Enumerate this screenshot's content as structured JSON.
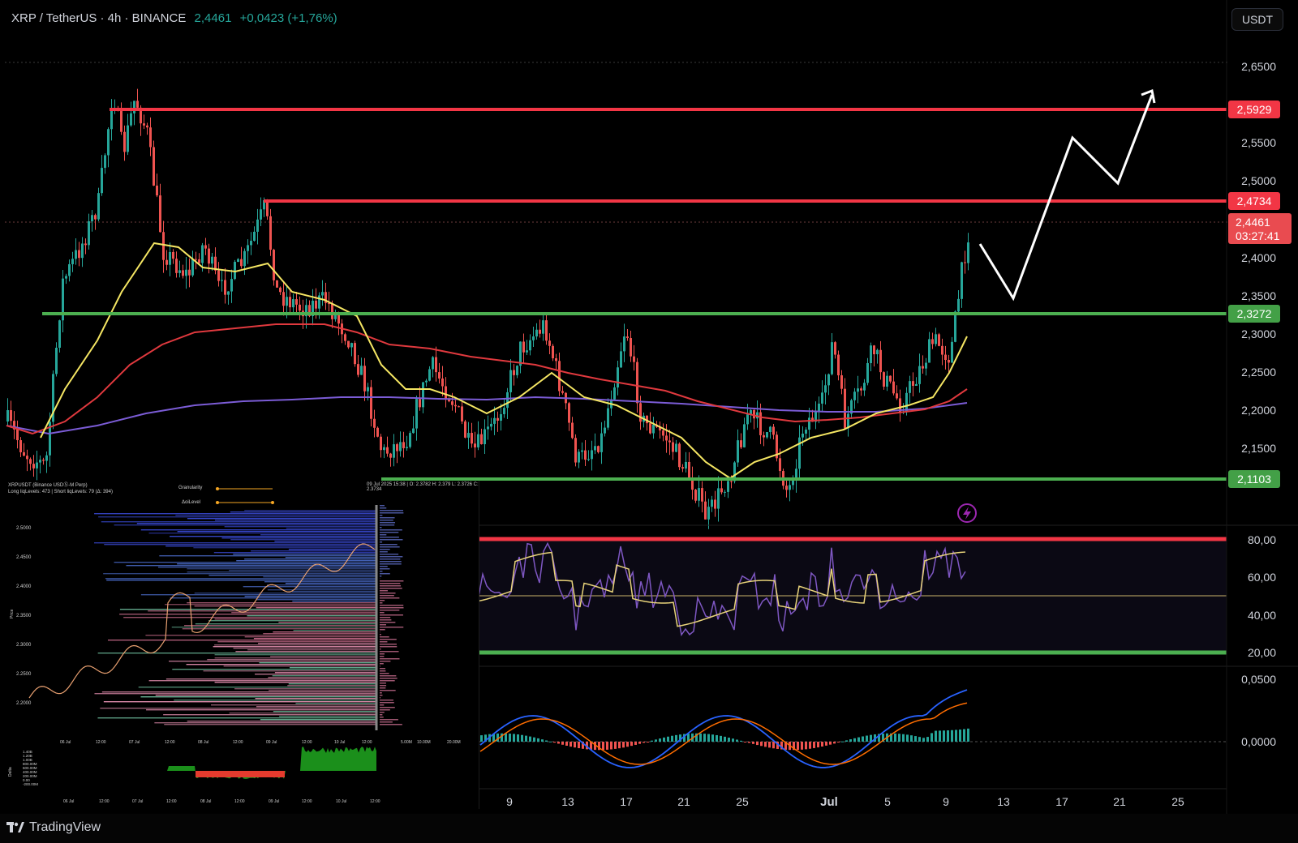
{
  "header": {
    "symbol": "XRP / TetherUS · 4h · BINANCE",
    "price": "2,4461",
    "change": "+0,0423 (+1,76%)"
  },
  "currency_button": "USDT",
  "price_axis": {
    "ticks": [
      "2,6500",
      "2,5500",
      "2,5000",
      "2,4000",
      "2,3500",
      "2,3000",
      "2,2500",
      "2,2000",
      "2,1500"
    ]
  },
  "levels": [
    {
      "label": "2,5929",
      "color": "#f23645"
    },
    {
      "label": "2,4734",
      "color": "#f23645"
    },
    {
      "label": "2,3272",
      "color": "#4caf50"
    },
    {
      "label": "2,1103",
      "color": "#4caf50"
    }
  ],
  "current_price": {
    "price": "2,4461",
    "countdown": "03:27:41"
  },
  "rsi_axis": {
    "ticks": [
      "80,00",
      "60,00",
      "40,00",
      "20,00"
    ]
  },
  "macd_axis": {
    "ticks": [
      "0,0500",
      "0,0000"
    ]
  },
  "time_axis": {
    "ticks": [
      "9",
      "13",
      "17",
      "21",
      "25",
      "Jul",
      "5",
      "9",
      "13",
      "17",
      "21",
      "25"
    ]
  },
  "liquidation_panel": {
    "title_line1": "XRPUSDT (Binance USDⓈ-M Perp)",
    "title_line2": "Long liqLevels: 473 | Short liqLevels: 79 (Δ: 394)",
    "ohlc": "09 Jul 2025 15:38 | O: 2.3782 H: 2.379 L: 2.3726 C: 2.3734",
    "setting1": "Granularity",
    "setting2": "ΔoiLevel",
    "y_ticks": [
      "2.5000",
      "2.4500",
      "2.4000",
      "2.3500",
      "2.3000",
      "2.2500",
      "2.2000"
    ],
    "y_label": "Price",
    "x_ticks": [
      "06 Jul",
      "12:00",
      "07 Jul",
      "12:00",
      "08 Jul",
      "12:00",
      "09 Jul",
      "12:00",
      "10 Jul",
      "12:00"
    ],
    "vol_ticks": [
      "5.00M",
      "10.00M",
      "20.00M"
    ],
    "delta_label": "Delta",
    "delta_ticks": [
      "1.40B",
      "1.20B",
      "1.00B",
      "800.00M",
      "600.00M",
      "400.00M",
      "200.00M",
      "0.00",
      "-200.00M"
    ],
    "delta_x_ticks": [
      "06 Jul",
      "12:00",
      "07 Jul",
      "12:00",
      "08 Jul",
      "12:00",
      "09 Jul",
      "12:00",
      "10 Jul",
      "12:00"
    ]
  },
  "footer": {
    "brand": "TradingView"
  },
  "colors": {
    "up": "#26a69a",
    "down": "#ef5350",
    "ema_fast": "#f5e663",
    "ema_mid": "#e0393e",
    "ema_slow": "#7b5cd6",
    "rsi": "#7e57c2",
    "rsi_ma": "#e8d37a",
    "macd": "#2962ff",
    "signal": "#ff6d00"
  }
}
